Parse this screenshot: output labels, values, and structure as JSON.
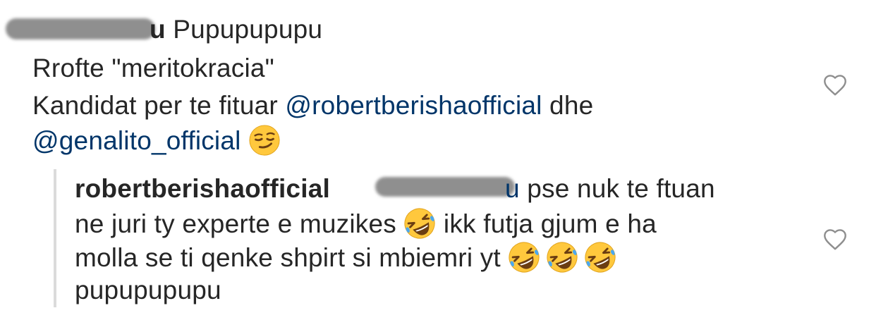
{
  "parent_comment": {
    "username_visible_suffix": "u",
    "username_tail_text": " Pupupupupu",
    "line1": "Rrofte \"meritokracia\"",
    "line2_prefix": "Kandidat per te fituar ",
    "line2_mention": "@robertberishaofficial",
    "line2_suffix": "  dhe",
    "line3_mention": "@genalito_official",
    "line3_emoji": "smirking-face-emoji",
    "like_icon": "heart-outline-icon"
  },
  "reply": {
    "username": "robertberishaofficial",
    "mention_visible_suffix": "u",
    "line1_text": " pse nuk te ftuan",
    "line2_text": "ne juri ty experte e muzikes ",
    "line2_emoji": "rolling-on-floor-laughing-emoji",
    "line2_tail": " ikk futja gjum e ha",
    "line3_text": "molla se ti qenke shpirt si mbiemri yt ",
    "line3_emojis": [
      "rolling-on-floor-laughing-emoji",
      "rolling-on-floor-laughing-emoji",
      "rolling-on-floor-laughing-emoji"
    ],
    "line4_text": "pupupupupu",
    "like_icon": "heart-outline-icon"
  },
  "colors": {
    "text": "#262626",
    "mention": "#003569",
    "heart_stroke": "#8e8e8e",
    "reply_rule": "#dbdbdb",
    "redaction": "#8f8f8f",
    "emoji_face": "#FFC83D"
  }
}
